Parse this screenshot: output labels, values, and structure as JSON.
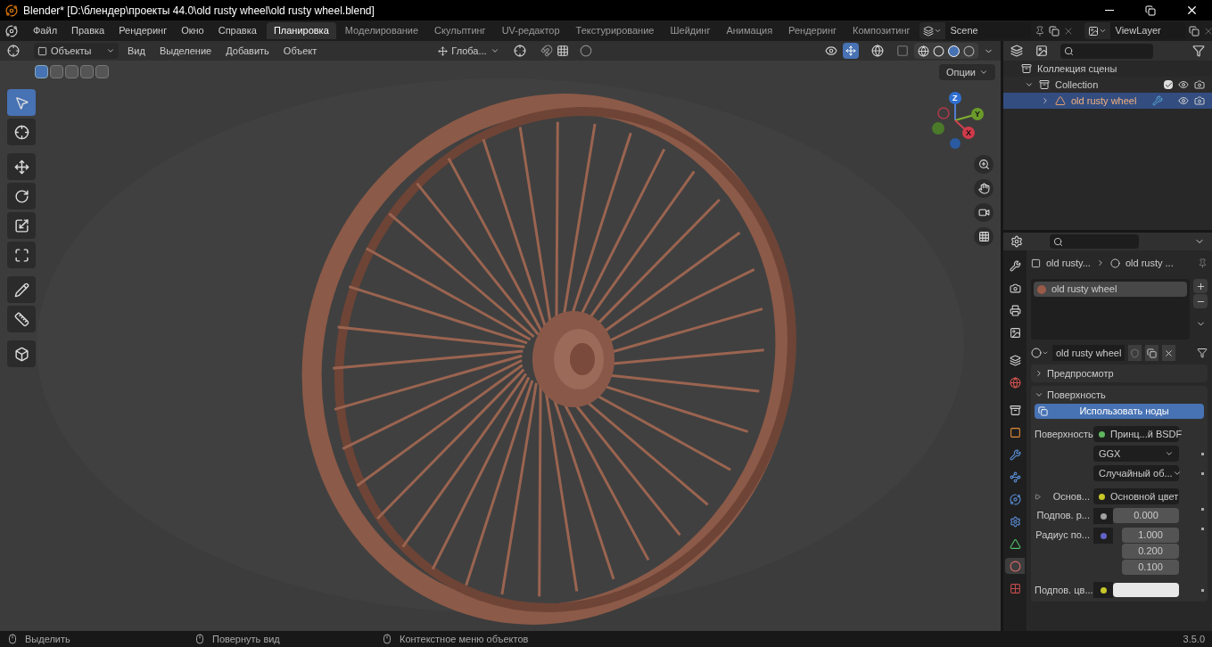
{
  "window": {
    "title": "Blender* [D:\\блендер\\проекты 44.0\\old rusty wheel\\old rusty wheel.blend]"
  },
  "menu": [
    "Файл",
    "Правка",
    "Рендеринг",
    "Окно",
    "Справка"
  ],
  "workspaces": [
    {
      "label": "Планировка",
      "selected": true
    },
    {
      "label": "Моделирование",
      "selected": false
    },
    {
      "label": "Скульптинг",
      "selected": false
    },
    {
      "label": "UV-редактор",
      "selected": false
    },
    {
      "label": "Текстурирование",
      "selected": false
    },
    {
      "label": "Шейдинг",
      "selected": false
    },
    {
      "label": "Анимация",
      "selected": false
    },
    {
      "label": "Рендеринг",
      "selected": false
    },
    {
      "label": "Композитинг",
      "selected": false
    }
  ],
  "scene": "Scene",
  "view_layer": "ViewLayer",
  "viewport": {
    "mode": "Объекты",
    "menus": [
      "Вид",
      "Выделение",
      "Добавить",
      "Объект"
    ],
    "orientation": "Глоба...",
    "options": "Опции",
    "select_modes": [
      {
        "selected": true
      },
      {
        "selected": false
      },
      {
        "selected": false
      },
      {
        "selected": false
      },
      {
        "selected": false
      }
    ],
    "tools": [
      {
        "kind": "select",
        "selected": true
      },
      {
        "kind": "cursor",
        "selected": false
      },
      {
        "kind": "move",
        "selected": false
      },
      {
        "kind": "rotate",
        "selected": false
      },
      {
        "kind": "scale",
        "selected": false
      },
      {
        "kind": "transform",
        "selected": false
      },
      {
        "kind": "annotate",
        "selected": false
      },
      {
        "kind": "measure",
        "selected": false
      },
      {
        "kind": "add",
        "selected": false
      }
    ],
    "axes": [
      "Z",
      "Y",
      "X"
    ]
  },
  "outliner": {
    "root": "Коллекция сцены",
    "children": [
      {
        "label": "Collection",
        "expanded": true,
        "checked": true,
        "selected": false,
        "children": [
          {
            "label": "old rusty wheel",
            "expanded": false,
            "selected": true
          }
        ]
      }
    ]
  },
  "properties": {
    "tabs": [
      {
        "kind": "tool",
        "selected": false
      },
      {
        "kind": "render",
        "selected": false
      },
      {
        "kind": "output",
        "selected": false
      },
      {
        "kind": "view",
        "selected": false
      },
      {
        "kind": "scene",
        "selected": false
      },
      {
        "kind": "world",
        "selected": false
      },
      {
        "kind": "collection",
        "selected": false
      },
      {
        "kind": "object",
        "selected": false
      },
      {
        "kind": "modifier",
        "selected": false
      },
      {
        "kind": "particles",
        "selected": false
      },
      {
        "kind": "physics",
        "selected": false
      },
      {
        "kind": "constraints",
        "selected": false
      },
      {
        "kind": "data",
        "selected": false
      },
      {
        "kind": "material",
        "selected": true
      },
      {
        "kind": "texture",
        "selected": false
      }
    ],
    "breadcrumb": [
      "old rusty...",
      "old rusty ..."
    ],
    "slots": [
      {
        "label": "old rusty wheel",
        "selected": true
      }
    ],
    "material": "old rusty wheel",
    "panels": [
      {
        "label": "Предпросмотр",
        "expanded": false
      },
      {
        "label": "Поверхность",
        "expanded": true
      }
    ],
    "use_nodes": "Использовать ноды",
    "fields": [
      {
        "kind": "link",
        "label": "Поверхность",
        "value": "Принц...й BSDF",
        "color": "#5fb55f"
      },
      {
        "kind": "dropdown",
        "value": "GGX"
      },
      {
        "kind": "dropdown",
        "value": "Случайный об..."
      },
      {
        "kind": "link",
        "label": "Основ...",
        "value": "Основной цвет",
        "color": "#c7c729",
        "expandable": true
      },
      {
        "kind": "number",
        "label": "Подпов. р...",
        "values": [
          "0.000"
        ],
        "color": "#a1a1a1"
      },
      {
        "kind": "number",
        "label": "Радиус по...",
        "values": [
          "1.000",
          "0.200",
          "0.100"
        ],
        "color": "#6363c7"
      },
      {
        "kind": "swatch",
        "label": "Подпов. цв...",
        "color": "#c7c729"
      }
    ]
  },
  "status_bar": {
    "items": [
      "Выделить",
      "Повернуть вид",
      "Контекстное меню объектов"
    ],
    "version": "3.5.0"
  }
}
